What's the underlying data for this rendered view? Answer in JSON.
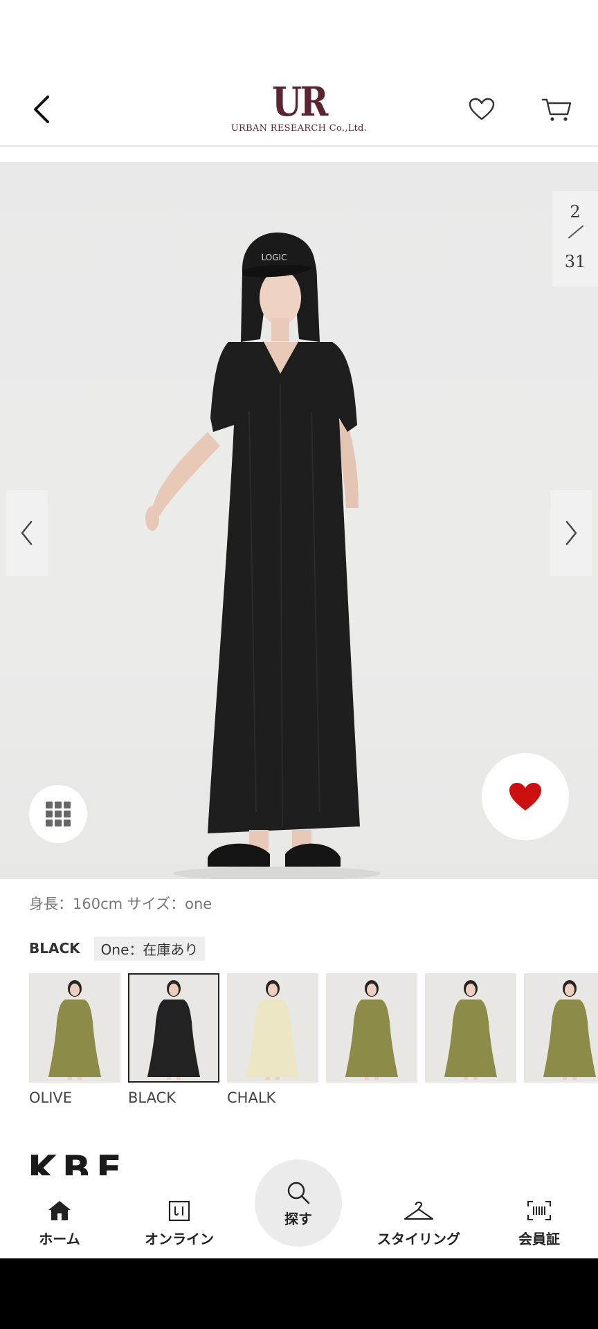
{
  "header": {
    "logo_mark": "UR",
    "logo_text": "URBAN RESEARCH Co.,Ltd."
  },
  "viewer": {
    "current": "2",
    "total": "31"
  },
  "product": {
    "model_info": "身長：160cm サイズ：one",
    "selected_color": "BLACK",
    "stock_status": "One：在庫あり"
  },
  "colors": [
    {
      "label": "OLIVE",
      "dress": "#8c8c48",
      "selected": false
    },
    {
      "label": "BLACK",
      "dress": "#222222",
      "selected": true
    },
    {
      "label": "CHALK",
      "dress": "#ece6c4",
      "selected": false
    },
    {
      "label": "",
      "dress": "#8c8c48",
      "selected": false
    },
    {
      "label": "",
      "dress": "#8c8c48",
      "selected": false
    },
    {
      "label": "",
      "dress": "#8c8c48",
      "selected": false
    }
  ],
  "brand_peek": "KBF",
  "bottom_nav": {
    "home": "ホーム",
    "online": "オンライン",
    "search": "探す",
    "styling": "スタイリング",
    "member": "会員証"
  },
  "accent": {
    "brand": "#5a2430",
    "heart": "#cc1010"
  }
}
